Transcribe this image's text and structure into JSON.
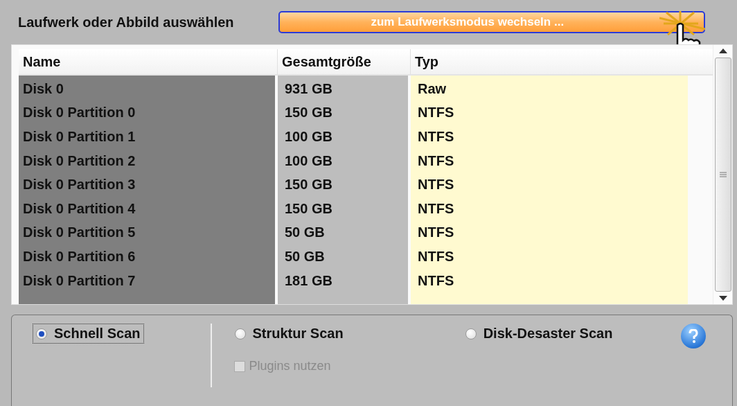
{
  "header": {
    "title": "Laufwerk oder Abbild auswählen",
    "switch_button": "zum Laufwerksmodus wechseln ..."
  },
  "table": {
    "columns": [
      "Name",
      "Gesamtgröße",
      "Typ"
    ],
    "rows": [
      {
        "name": "Disk 0",
        "size": "931 GB",
        "type": "Raw"
      },
      {
        "name": "Disk 0 Partition 0",
        "size": "150 GB",
        "type": "NTFS"
      },
      {
        "name": "Disk 0 Partition 1",
        "size": "100 GB",
        "type": "NTFS"
      },
      {
        "name": "Disk 0 Partition 2",
        "size": "100 GB",
        "type": "NTFS"
      },
      {
        "name": "Disk 0 Partition 3",
        "size": "150 GB",
        "type": "NTFS"
      },
      {
        "name": "Disk 0 Partition 4",
        "size": "150 GB",
        "type": "NTFS"
      },
      {
        "name": "Disk 0 Partition 5",
        "size": "50 GB",
        "type": "NTFS"
      },
      {
        "name": "Disk 0 Partition 6",
        "size": "50 GB",
        "type": "NTFS"
      },
      {
        "name": "Disk 0 Partition 7",
        "size": "181 GB",
        "type": "NTFS"
      }
    ]
  },
  "scan_options": [
    {
      "label": "Schnell Scan",
      "selected": true
    },
    {
      "label": "Struktur Scan",
      "selected": false
    },
    {
      "label": "Disk-Desaster Scan",
      "selected": false
    }
  ],
  "plugins": {
    "label": "Plugins nutzen",
    "checked": false,
    "disabled": true
  }
}
